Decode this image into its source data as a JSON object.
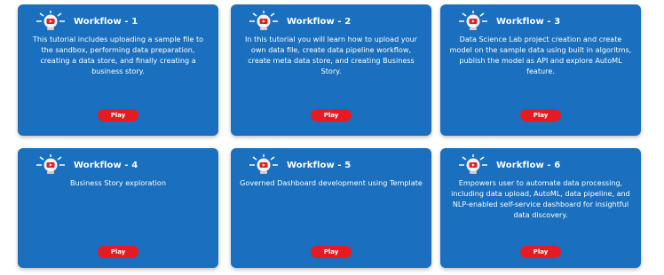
{
  "workflows": [
    {
      "title": "Workflow - 1",
      "description": "This tutorial includes uploading a sample file to the sandbox, performing data preparation, creating a data store, and finally creating a business story.",
      "play_label": "Play",
      "icon": "video-bulb-icon"
    },
    {
      "title": "Workflow - 2",
      "description": "In this tutorial you will learn how to upload your own data file, create data pipeline workflow, create meta data store, and creating Business Story.",
      "play_label": "Play",
      "icon": "video-bulb-icon"
    },
    {
      "title": "Workflow - 3",
      "description": "Data Science Lab project creation and create model on the sample data using built in algoritms, publish the model as API and explore AutoML feature.",
      "play_label": "Play",
      "icon": "video-bulb-icon"
    },
    {
      "title": "Workflow - 4",
      "description": "Business Story exploration",
      "play_label": "Play",
      "icon": "video-bulb-icon"
    },
    {
      "title": "Workflow - 5",
      "description": "Governed Dashboard development using Template",
      "play_label": "Play",
      "icon": "video-bulb-icon"
    },
    {
      "title": "Workflow - 6",
      "description": "Empowers user to automate data processing, including data upload, AutoML, data pipeline, and NLP-enabled self-service dashboard for insightful data discovery.",
      "play_label": "Play",
      "icon": "video-bulb-icon"
    }
  ],
  "colors": {
    "card_bg": "#1a6fbe",
    "play_button": "#e51b23",
    "text": "#ffffff",
    "icon_bulb": "#f3f3f3",
    "icon_play": "#e51b23"
  }
}
